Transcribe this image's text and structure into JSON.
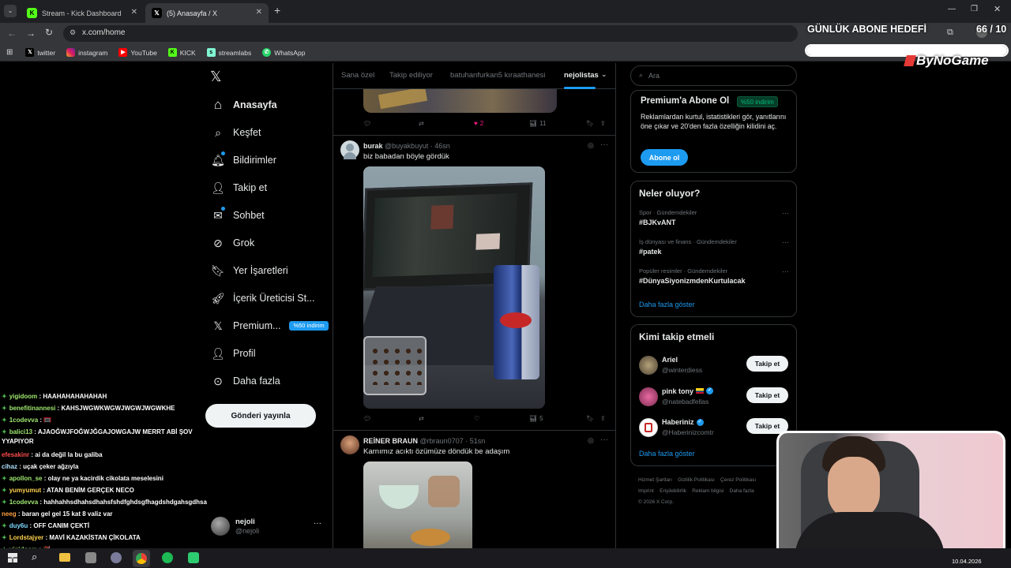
{
  "browser": {
    "tabs": [
      {
        "title": "Stream - Kick Dashboard",
        "active": false
      },
      {
        "title": "(5) Anasayfa / X",
        "active": true
      }
    ],
    "url": "x.com/home",
    "bookmarks": [
      "twitter",
      "instagram",
      "YouTube",
      "KICK",
      "streamlabs",
      "WhatsApp"
    ]
  },
  "overlay": {
    "goal_label": "GÜNLÜK ABONE HEDEFİ",
    "goal_count": "66 / 10",
    "goal_progress": 1.0,
    "brand": "ByNoGame"
  },
  "nav": {
    "items": [
      {
        "label": "Anasayfa",
        "icon": "home-icon",
        "bold": true
      },
      {
        "label": "Keşfet",
        "icon": "search-icon"
      },
      {
        "label": "Bildirimler",
        "icon": "bell-icon"
      },
      {
        "label": "Takip et",
        "icon": "follow-icon"
      },
      {
        "label": "Sohbet",
        "icon": "chat-icon"
      },
      {
        "label": "Grok",
        "icon": "grok-icon"
      },
      {
        "label": "Yer İşaretleri",
        "icon": "bookmark-icon"
      },
      {
        "label": "İçerik Üreticisi St...",
        "icon": "rocket-icon"
      },
      {
        "label": "Premium...",
        "icon": "x-icon"
      },
      {
        "label": "Profil",
        "icon": "person-icon"
      },
      {
        "label": "Daha fazla",
        "icon": "more-circle-icon"
      }
    ],
    "premium_badge": "%50 indirim",
    "post_button": "Gönderi yayınla",
    "account_name": "nejoli",
    "account_handle": "@nejoli"
  },
  "feed": {
    "tabs": [
      "Sana özel",
      "Takip ediliyor",
      "batuhanfurkan5 kıraathanesi",
      "nejolistas"
    ],
    "top_actions": {
      "likes": "2",
      "views": "11"
    },
    "posts": [
      {
        "name": "burak",
        "handle": "@buyakbuyut",
        "time": "46sn",
        "text": "biz babadan böyle gördük",
        "views": "5"
      },
      {
        "name": "REİNER BRAUN",
        "handle": "@rbraun0707",
        "time": "51sn",
        "text": "Karnımız acıktı özümüze döndük be adaşım"
      }
    ]
  },
  "right": {
    "search_placeholder": "Ara",
    "premium": {
      "title": "Premium'a Abone Ol",
      "badge": "%50 indirim",
      "desc": "Reklamlardan kurtul, istatistikleri gör, yanıtlarını öne çıkar ve 20'den fazla özelliğin kilidini aç.",
      "button": "Abone ol"
    },
    "trends": {
      "title": "Neler oluyor?",
      "items": [
        {
          "meta": "Spor · Gündemdekiler",
          "name": "#BJKvANT"
        },
        {
          "meta": "İş dünyası ve finans · Gündemdekiler",
          "name": "#patek"
        },
        {
          "meta": "Popüler resimler · Gündemdekiler",
          "name": "#DünyaSiyonizmdenKurtulacak"
        }
      ],
      "more": "Daha fazla göster"
    },
    "who_to_follow": {
      "title": "Kimi takip etmeli",
      "items": [
        {
          "name": "Ariel",
          "handle": "@winterdiess",
          "button": "Takip et"
        },
        {
          "name": "pink tony",
          "handle": "@natebadfellas",
          "button": "Takip et"
        },
        {
          "name": "Haberiniz",
          "handle": "@Haberinizcomtr",
          "button": "Takip et"
        }
      ],
      "more": "Daha fazla göster"
    },
    "footer": [
      "Hizmet Şartları",
      "Gizlilik Politikası",
      "Çerez Politikası",
      "Imprint",
      "Erişilebilirlik",
      "Reklam bilgisi",
      "Daha fazla",
      "© 2026 X Corp."
    ]
  },
  "chat": [
    {
      "user": "yigidoom",
      "msg": "HAAHAHAHAHAHAH"
    },
    {
      "user": "benefitinannesi",
      "msg": "KAHSJWGWKWGWJWGWJWGWKHE"
    },
    {
      "user": "1codevva",
      "msg": "🥅"
    },
    {
      "user": "balici13",
      "msg": "AJAOĞWJFOĞWJĞGAJOWGAJW MERRT ABİ ŞOV YYAPIYOR"
    },
    {
      "user": "efesakinr",
      "msg": "ai da değil la bu galiba"
    },
    {
      "user": "cihaz",
      "msg": "uçak çeker ağzıyla"
    },
    {
      "user": "apollon_se",
      "msg": "olay ne ya kacirdik cikolata meselesini"
    },
    {
      "user": "yumyumut",
      "msg": "ATAN BENİM GERÇEK NECO"
    },
    {
      "user": "1codevva",
      "msg": "hahhahhsdhahsdhahsfshdfghdsgfhagdshdgahsgdhsa"
    },
    {
      "user": "neeg",
      "msg": "baran gel gel 15 kat 8 valiz var"
    },
    {
      "user": "duy6u",
      "msg": "OFF CANIM ÇEKTİ"
    },
    {
      "user": "Lordstajyer",
      "msg": "MAVİ KAZAKİSTAN ÇİKOLATA"
    },
    {
      "user": "yigidoom",
      "msg": "🎉"
    }
  ],
  "taskbar": {
    "date": "10.04.2026"
  }
}
